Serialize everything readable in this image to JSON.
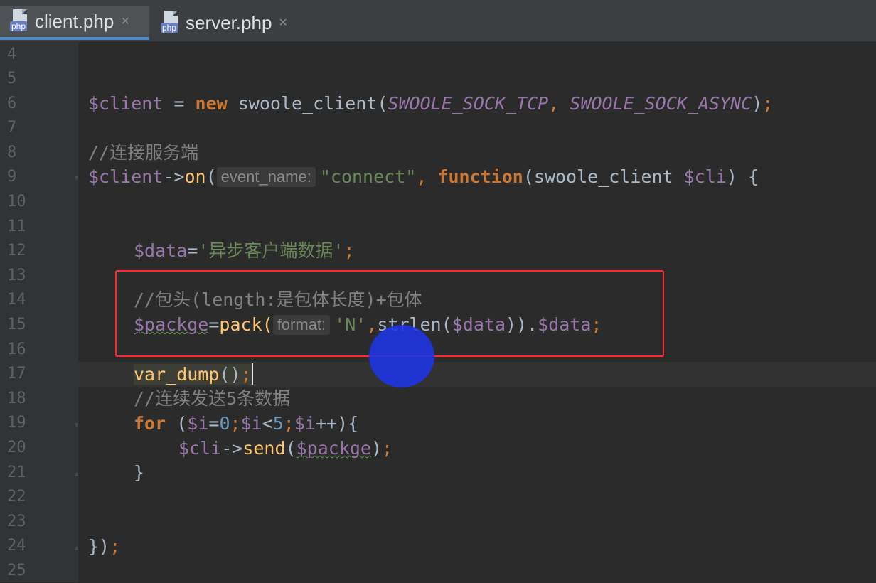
{
  "tabs": [
    {
      "label": "client.php",
      "badge": "php",
      "active": true,
      "close": "×"
    },
    {
      "label": "server.php",
      "badge": "php",
      "active": false,
      "close": "×"
    }
  ],
  "line_numbers": [
    "4",
    "5",
    "6",
    "7",
    "8",
    "9",
    "10",
    "11",
    "12",
    "13",
    "14",
    "15",
    "16",
    "17",
    "18",
    "19",
    "20",
    "21",
    "22",
    "23",
    "24",
    "25"
  ],
  "code": {
    "l6": {
      "var": "$client",
      "eq": " = ",
      "kw_new": "new",
      "cls": " swoole_client(",
      "c1": "SWOOLE_SOCK_TCP",
      "comma": ", ",
      "c2": "SWOOLE_SOCK_ASYNC",
      "close": ")",
      "semi": ";"
    },
    "l8": {
      "comment": "//连接服务端"
    },
    "l9": {
      "var": "$client",
      "arrow": "->",
      "method": "on",
      "paren": "(",
      "hint": "event_name:",
      "str": "\"connect\"",
      "comma": ", ",
      "kw": "function",
      "args": "(swoole_client ",
      "arg_var": "$cli",
      "tail": ") {"
    },
    "l12": {
      "var": "$data",
      "eq": "=",
      "str": "'异步客户端数据'",
      "semi": ";"
    },
    "l14": {
      "comment": "//包头(length:是包体长度)+包体"
    },
    "l15": {
      "var": "$packge",
      "eq": "=",
      "fn": "pack(",
      "hint": "format:",
      "str": "'N'",
      "comma": ",",
      "fn2": "strlen(",
      "var2": "$data",
      "close": ")).",
      "var3": "$data",
      "semi": ";"
    },
    "l17": {
      "fn": "var_dump",
      "parens": "()",
      "semi": ";"
    },
    "l18": {
      "comment": "//连续发送5条数据"
    },
    "l19": {
      "kw": "for",
      "open": " (",
      "var1": "$i",
      "eq": "=",
      "n0": "0",
      "s1": ";",
      "var2": "$i",
      "lt": "<",
      "n5": "5",
      "s2": ";",
      "var3": "$i",
      "inc": "++){"
    },
    "l20": {
      "var": "$cli",
      "arrow": "->",
      "method": "send",
      "open": "(",
      "arg": "$packge",
      "close": ")",
      "semi": ";"
    },
    "l21": {
      "brace": "}"
    },
    "l24": {
      "close": "})",
      "semi": ";"
    }
  },
  "colors": {
    "background": "#2b2b2b",
    "highlight_box": "#ff2a2a",
    "cursor_blob": "#1f33e6"
  }
}
